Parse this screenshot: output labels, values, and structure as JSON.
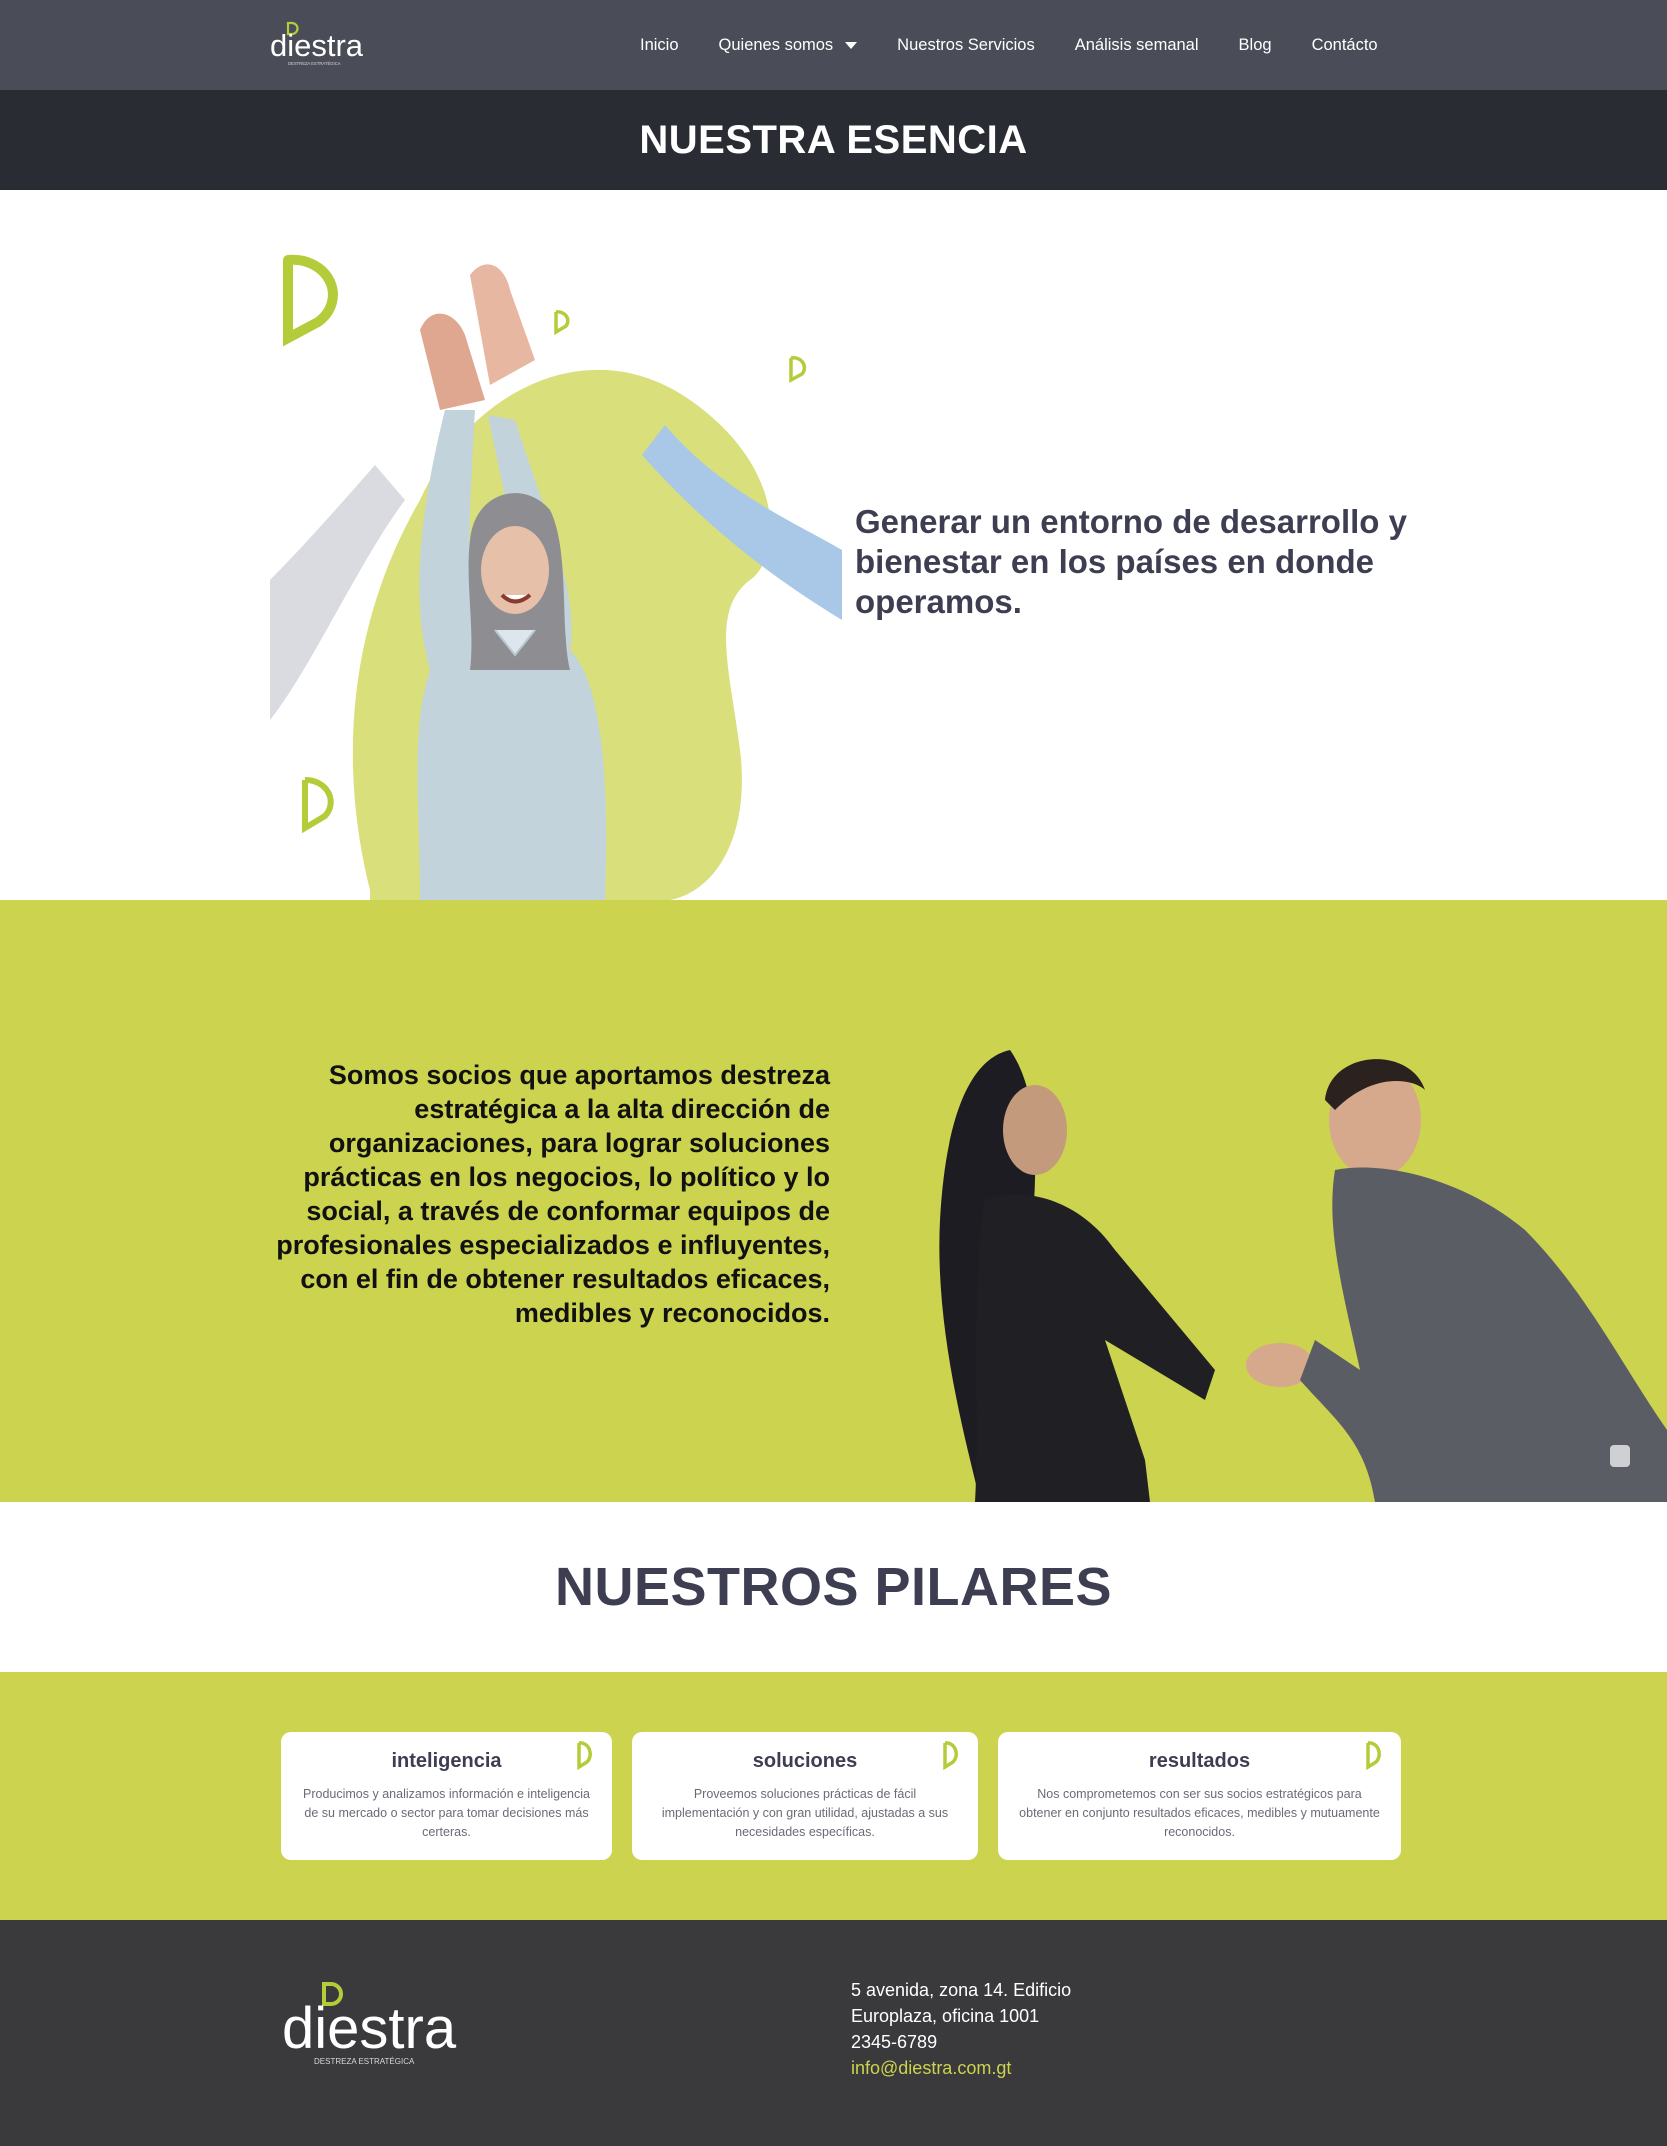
{
  "nav": {
    "logo_text": "diestra",
    "logo_tagline": "DESTREZA ESTRATÉGICA",
    "links": [
      {
        "label": "Inicio"
      },
      {
        "label": "Quienes somos"
      },
      {
        "label": "Nuestros Servicios"
      },
      {
        "label": "Análisis semanal"
      },
      {
        "label": "Blog"
      },
      {
        "label": "Contácto"
      }
    ]
  },
  "title_bar": {
    "title": "NUESTRA ESENCIA"
  },
  "esencia": {
    "statement": "Generar un entorno de desarrollo y bienestar  en los países en donde operamos."
  },
  "socios": {
    "statement": "Somos socios que aportamos destreza estratégica a la alta dirección de organizaciones, para lograr soluciones prácticas en los negocios, lo político y lo social, a través de conformar equipos de profesionales especializados e influyentes, con el fin de obtener resultados eficaces, medibles y reconocidos."
  },
  "pilares": {
    "heading": "NUESTROS PILARES",
    "cards": [
      {
        "title": "inteligencia",
        "text": "Producimos y analizamos información e inteligencia de su mercado o sector para tomar decisiones más certeras."
      },
      {
        "title": "soluciones",
        "text": "Proveemos soluciones prácticas de fácil implementación y con gran utilidad, ajustadas a sus necesidades específicas."
      },
      {
        "title": "resultados",
        "text": "Nos comprometemos con ser sus socios estratégicos para obtener en conjunto resultados eficaces, medibles y mutuamente reconocidos."
      }
    ]
  },
  "footer": {
    "logo_text": "diestra",
    "logo_tagline": "DESTREZA ESTRATÉGICA",
    "address_line1": "5 avenida, zona 14. Edificio",
    "address_line2": "Europlaza, oficina 1001",
    "phone": "2345-6789",
    "email": "info@diestra.com.gt"
  },
  "colors": {
    "accent": "#ccd34e",
    "nav_bg": "#4a4c57",
    "title_bg": "#2a2c33",
    "footer_bg": "#3a3a3c",
    "heading_text": "#3e3e52"
  },
  "icons": [
    "dropdown-caret-icon",
    "d-brand-icon"
  ]
}
